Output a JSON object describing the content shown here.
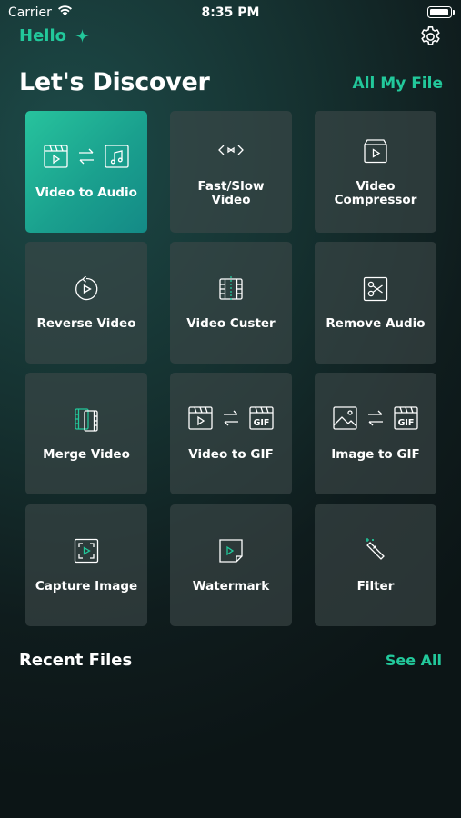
{
  "status_bar": {
    "carrier": "Carrier",
    "time": "8:35 PM"
  },
  "header": {
    "greeting": "Hello"
  },
  "section": {
    "title": "Let's Discover",
    "link": "All My File"
  },
  "tools": [
    {
      "label": "Video to Audio",
      "icon": "video-to-audio-icon",
      "active": true
    },
    {
      "label": "Fast/Slow Video",
      "icon": "speed-icon"
    },
    {
      "label": "Video Compressor",
      "icon": "compress-icon"
    },
    {
      "label": "Reverse Video",
      "icon": "reverse-icon"
    },
    {
      "label": "Video Custer",
      "icon": "film-cut-icon"
    },
    {
      "label": "Remove Audio",
      "icon": "scissors-icon"
    },
    {
      "label": "Merge Video",
      "icon": "merge-icon"
    },
    {
      "label": "Video to GIF",
      "icon": "video-to-gif-icon"
    },
    {
      "label": "Image to GIF",
      "icon": "image-to-gif-icon"
    },
    {
      "label": "Capture Image",
      "icon": "capture-icon"
    },
    {
      "label": "Watermark",
      "icon": "watermark-icon"
    },
    {
      "label": "Filter",
      "icon": "magic-wand-icon"
    }
  ],
  "recent": {
    "title": "Recent Files",
    "link": "See All"
  },
  "colors": {
    "accent": "#22c89b",
    "tile": "#3e4849",
    "background": "#0f1c1d"
  }
}
